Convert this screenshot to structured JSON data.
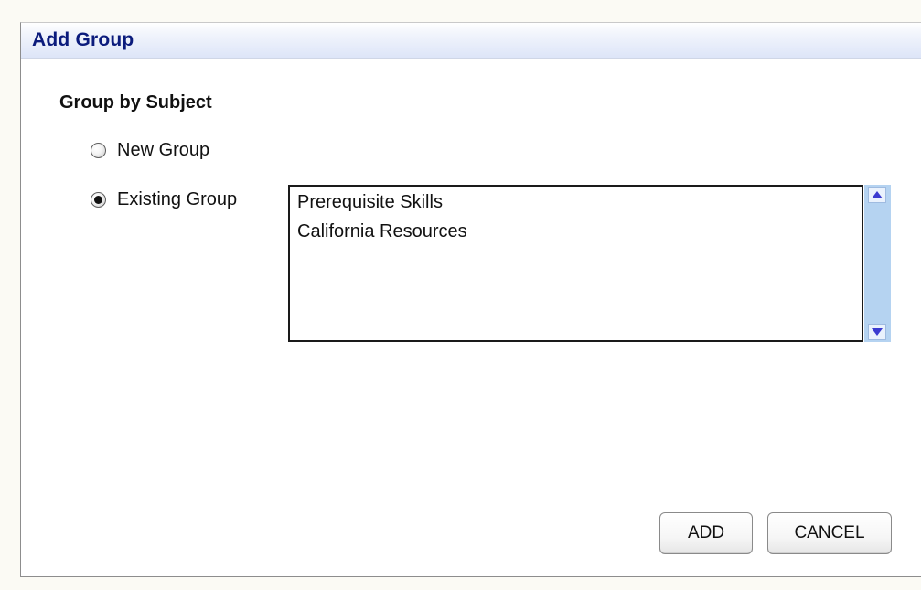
{
  "dialog": {
    "title": "Add Group",
    "section_label": "Group by Subject",
    "options": [
      {
        "label": "New Group",
        "checked": false
      },
      {
        "label": "Existing Group",
        "checked": true
      }
    ],
    "existing_groups": [
      "Prerequisite Skills",
      "California Resources"
    ],
    "buttons": {
      "add_label": "ADD",
      "cancel_label": "CANCEL"
    }
  },
  "colors": {
    "title_text": "#0b1b7c",
    "scrollbar_track": "#b5d3f1",
    "scroll_arrow": "#3b3bd0"
  },
  "icons": {
    "scroll_up": "triangle-up",
    "scroll_down": "triangle-down"
  }
}
